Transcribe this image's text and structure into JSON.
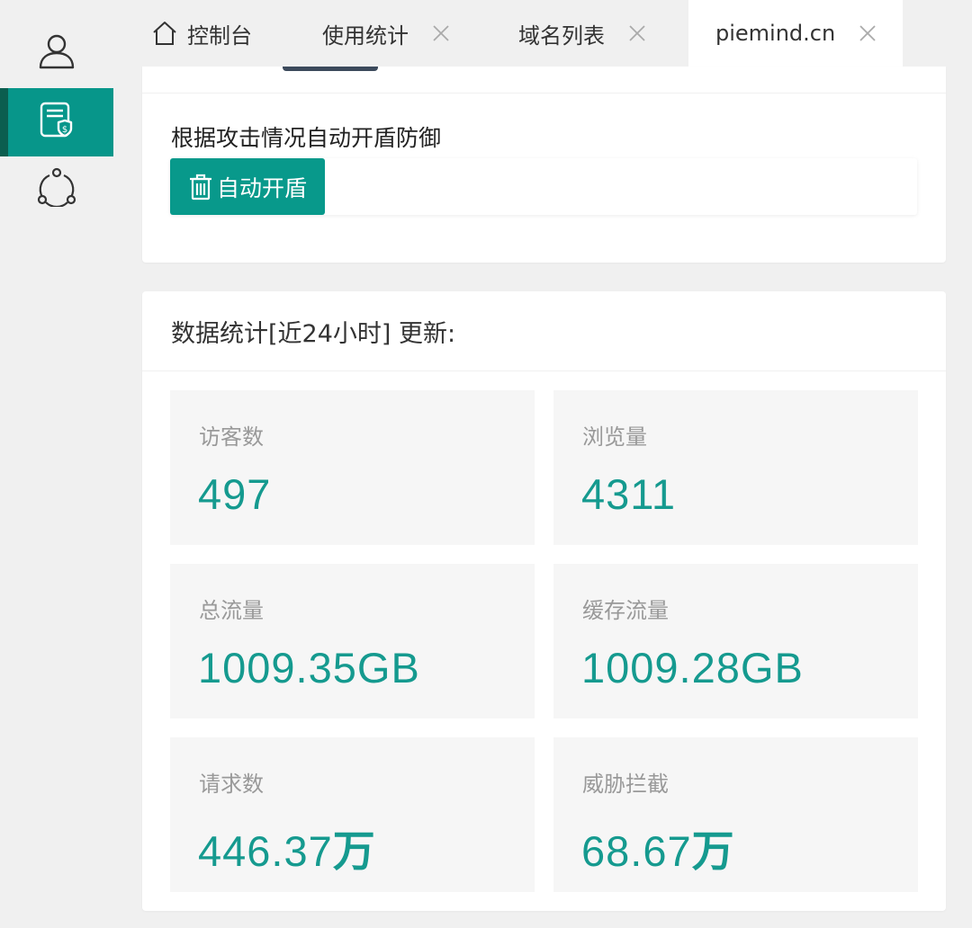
{
  "tabs": [
    {
      "label": "控制台",
      "icon": "home-icon"
    },
    {
      "label": "使用统计",
      "closable": true
    },
    {
      "label": "域名列表",
      "closable": true
    },
    {
      "label": "piemind.cn",
      "closable": true,
      "active": true
    }
  ],
  "sidebar": {
    "items": [
      {
        "icon": "user-icon"
      },
      {
        "icon": "document-shield-icon",
        "active": true
      },
      {
        "icon": "network-icon"
      }
    ]
  },
  "auto_shield": {
    "description": "根据攻击情况自动开盾防御",
    "button_label": "自动开盾",
    "button_icon": "trash-icon"
  },
  "stats": {
    "title": "数据统计[近24小时] 更新:",
    "items": [
      {
        "label": "访客数",
        "value": "497",
        "unit": ""
      },
      {
        "label": "浏览量",
        "value": "4311",
        "unit": ""
      },
      {
        "label": "总流量",
        "value": "1009.35GB",
        "unit": ""
      },
      {
        "label": "缓存流量",
        "value": "1009.28GB",
        "unit": ""
      },
      {
        "label": "请求数",
        "value": "446.37",
        "unit": "万"
      },
      {
        "label": "威胁拦截",
        "value": "68.67",
        "unit": "万"
      }
    ]
  },
  "colors": {
    "accent": "#07968a",
    "accent_dark": "#0b5e4f",
    "value_text": "#159a8f",
    "background": "#f0f0f0"
  }
}
